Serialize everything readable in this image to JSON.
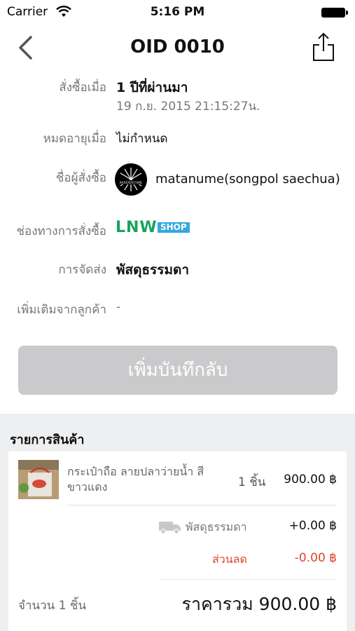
{
  "status_bar": {
    "carrier": "Carrier",
    "time": "5:16 PM"
  },
  "nav": {
    "title": "OID 0010",
    "back_icon": "chevron-left-icon",
    "share_icon": "share-icon"
  },
  "order": {
    "ordered_label": "สั่งซื้อเมื่อ",
    "ordered_relative": "1 ปีที่ผ่านมา",
    "ordered_date": "19 ก.ย. 2015  21:15:27น.",
    "expires_label": "หมดอายุเมื่อ",
    "expires_value": "ไม่กำหนด",
    "buyer_label": "ชื่อผู้สั่งซื้อ",
    "buyer_name": "matanume(songpol saechua)",
    "channel_label": "ช่องทางการสั่งซื้อ",
    "channel_logo_text": "LNW",
    "channel_logo_badge": "SHOP",
    "shipping_label": "การจัดส่ง",
    "shipping_value": "พัสดุธรรมดา",
    "note_label": "เพิ่มเติมจากลูกค้า",
    "note_value": "-"
  },
  "add_note_button": "เพิ่มบันทึกลับ",
  "items_section": {
    "title": "รายการสินค้า",
    "items": [
      {
        "name": "กระเป๋าถือ ลายปลาว่ายน้ำ สีขาวแดง",
        "qty": "1 ชิ้น",
        "price": "900.00 ฿"
      }
    ],
    "shipping_label": "พัสดุธรรมดา",
    "shipping_price": "+0.00 ฿",
    "discount_label": "ส่วนลด",
    "discount_price": "-0.00 ฿",
    "quantity_total": "จำนวน 1 ชิ้น",
    "grand_total": "ราคารวม 900.00 ฿"
  },
  "colors": {
    "discount": "#e0432f",
    "button_disabled": "#cacacc",
    "lnw_green": "#1aa260",
    "lnw_blue": "#35a8e0"
  }
}
